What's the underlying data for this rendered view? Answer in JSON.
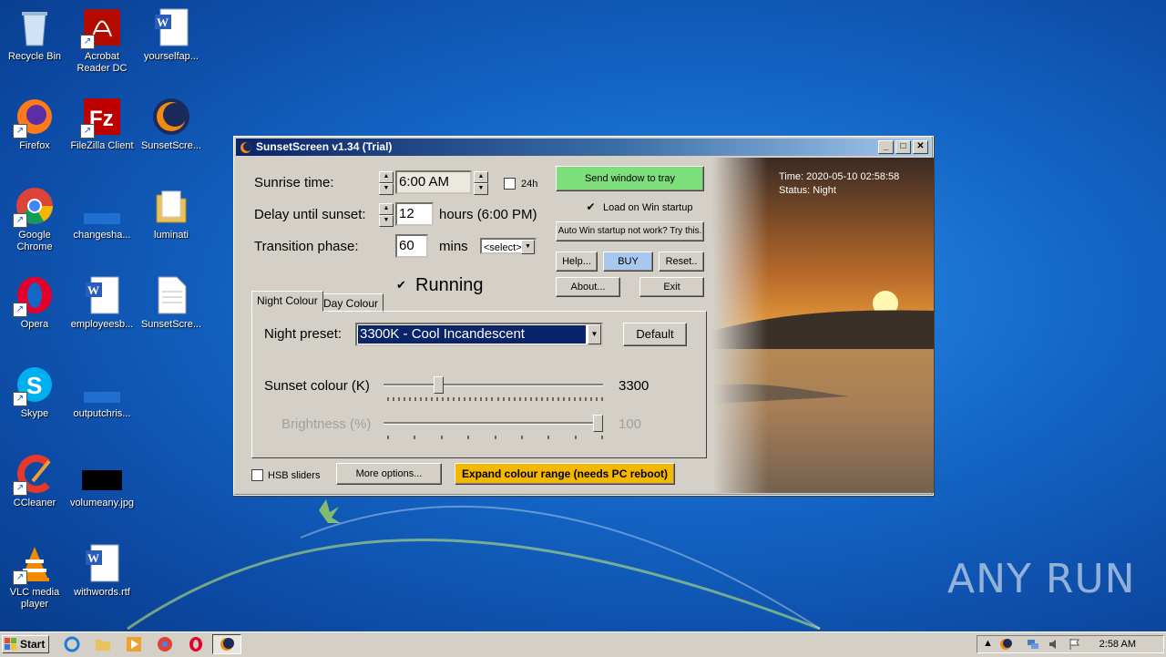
{
  "desktop": {
    "icons": [
      {
        "label": "Recycle Bin"
      },
      {
        "label": "Acrobat Reader DC"
      },
      {
        "label": "yourselfap..."
      },
      {
        "label": "Firefox"
      },
      {
        "label": "FileZilla Client"
      },
      {
        "label": "SunsetScre..."
      },
      {
        "label": "Google Chrome"
      },
      {
        "label": "changesha..."
      },
      {
        "label": "luminati"
      },
      {
        "label": "Opera"
      },
      {
        "label": "employeesb..."
      },
      {
        "label": "SunsetScre..."
      },
      {
        "label": "Skype"
      },
      {
        "label": "outputchris..."
      },
      {
        "label": "CCleaner"
      },
      {
        "label": "volumeany.jpg"
      },
      {
        "label": "VLC media player"
      },
      {
        "label": "withwords.rtf"
      }
    ],
    "watermark": "ANY RUN"
  },
  "window": {
    "title": "SunsetScreen v1.34 (Trial)",
    "sunrise_label": "Sunrise time:",
    "sunrise_value": "6:00 AM",
    "h24_label": "24h",
    "delay_label": "Delay until sunset:",
    "delay_value": "12",
    "delay_suffix": "hours  (6:00 PM)",
    "transition_label": "Transition phase:",
    "transition_value": "60",
    "transition_unit": "mins",
    "transition_select": "<select>",
    "running_label": "Running",
    "send_tray": "Send window to tray",
    "load_startup": "Load on Win startup",
    "auto_startup": "Auto Win startup not work? Try this.",
    "help": "Help...",
    "buy": "BUY",
    "reset": "Reset..",
    "about": "About...",
    "exit": "Exit",
    "tabs": [
      "Night Colour",
      "Day Colour"
    ],
    "night_preset_label": "Night preset:",
    "night_preset_value": "3300K - Cool Incandescent",
    "default_btn": "Default",
    "sunset_colour_label": "Sunset colour (K)",
    "sunset_colour_value": "3300",
    "sunset_colour_level": 0.24,
    "brightness_label": "Brightness (%)",
    "brightness_value": "100",
    "brightness_level": 1.0,
    "hsb_label": "HSB sliders",
    "more_options": "More options...",
    "expand_range": "Expand colour range (needs PC reboot)",
    "time_text": "Time: 2020-05-10 02:58:58",
    "status_text": "Status: Night"
  },
  "taskbar": {
    "start_label": "Start",
    "clock": "2:58 AM"
  },
  "colors": {
    "send_tray_bg": "#7ee07a",
    "buy_bg": "#a8c8f0",
    "expand_bg": "#f5b800",
    "preset_bg": "#0a246a"
  }
}
